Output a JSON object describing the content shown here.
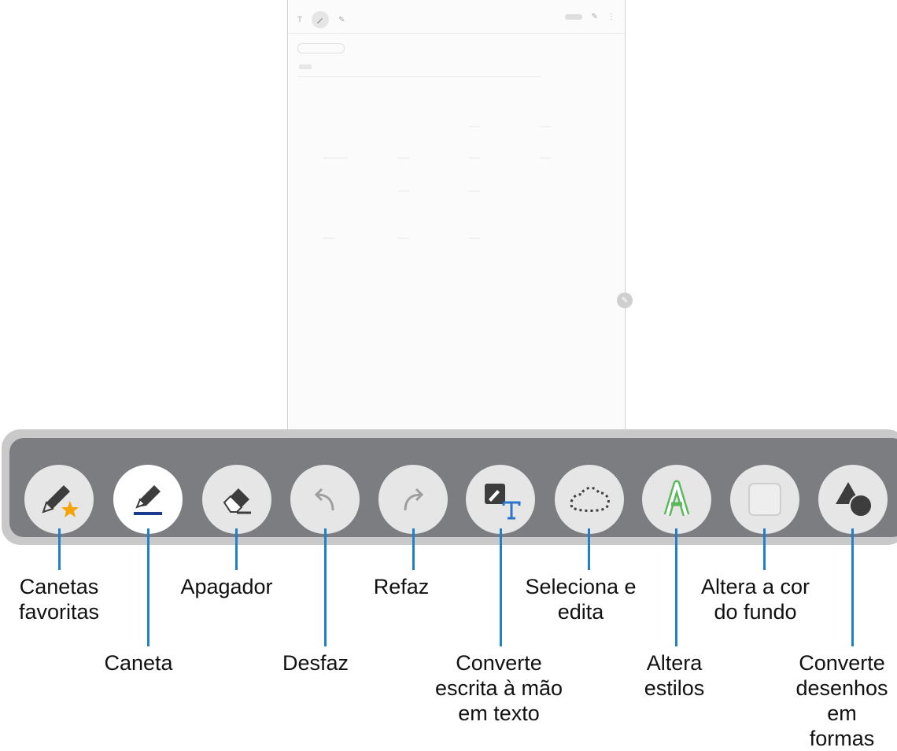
{
  "toolbar": {
    "tools": [
      {
        "id": "favorite-pens",
        "label": "Canetas\nfavoritas",
        "icon": "pen-star-icon",
        "active": false
      },
      {
        "id": "pen",
        "label": "Caneta",
        "icon": "fountain-pen-icon",
        "active": true
      },
      {
        "id": "eraser",
        "label": "Apagador",
        "icon": "eraser-icon",
        "active": false
      },
      {
        "id": "undo",
        "label": "Desfaz",
        "icon": "undo-icon",
        "active": false
      },
      {
        "id": "redo",
        "label": "Refaz",
        "icon": "redo-icon",
        "active": false
      },
      {
        "id": "handwriting-to-text",
        "label": "Converte\nescrita à mão\nem texto",
        "icon": "handwriting-to-text-icon",
        "active": false
      },
      {
        "id": "select-edit",
        "label": "Seleciona e\nedita",
        "icon": "lasso-select-icon",
        "active": false
      },
      {
        "id": "styles",
        "label": "Altera\nestilos",
        "icon": "style-letter-icon",
        "active": false
      },
      {
        "id": "background-color",
        "label": "Altera a cor\ndo fundo",
        "icon": "background-square-icon",
        "active": false
      },
      {
        "id": "shapes",
        "label": "Converte\ndesenhos\nem formas",
        "icon": "shapes-icon",
        "active": false
      }
    ]
  },
  "colors": {
    "toolbar_bg": "#7b7d80",
    "callout": "#1f7fc9",
    "pen_underline": "#1a3a8f",
    "star": "#f5a300",
    "style_green": "#5cb85c",
    "text_tool_blue": "#2a74c9"
  }
}
